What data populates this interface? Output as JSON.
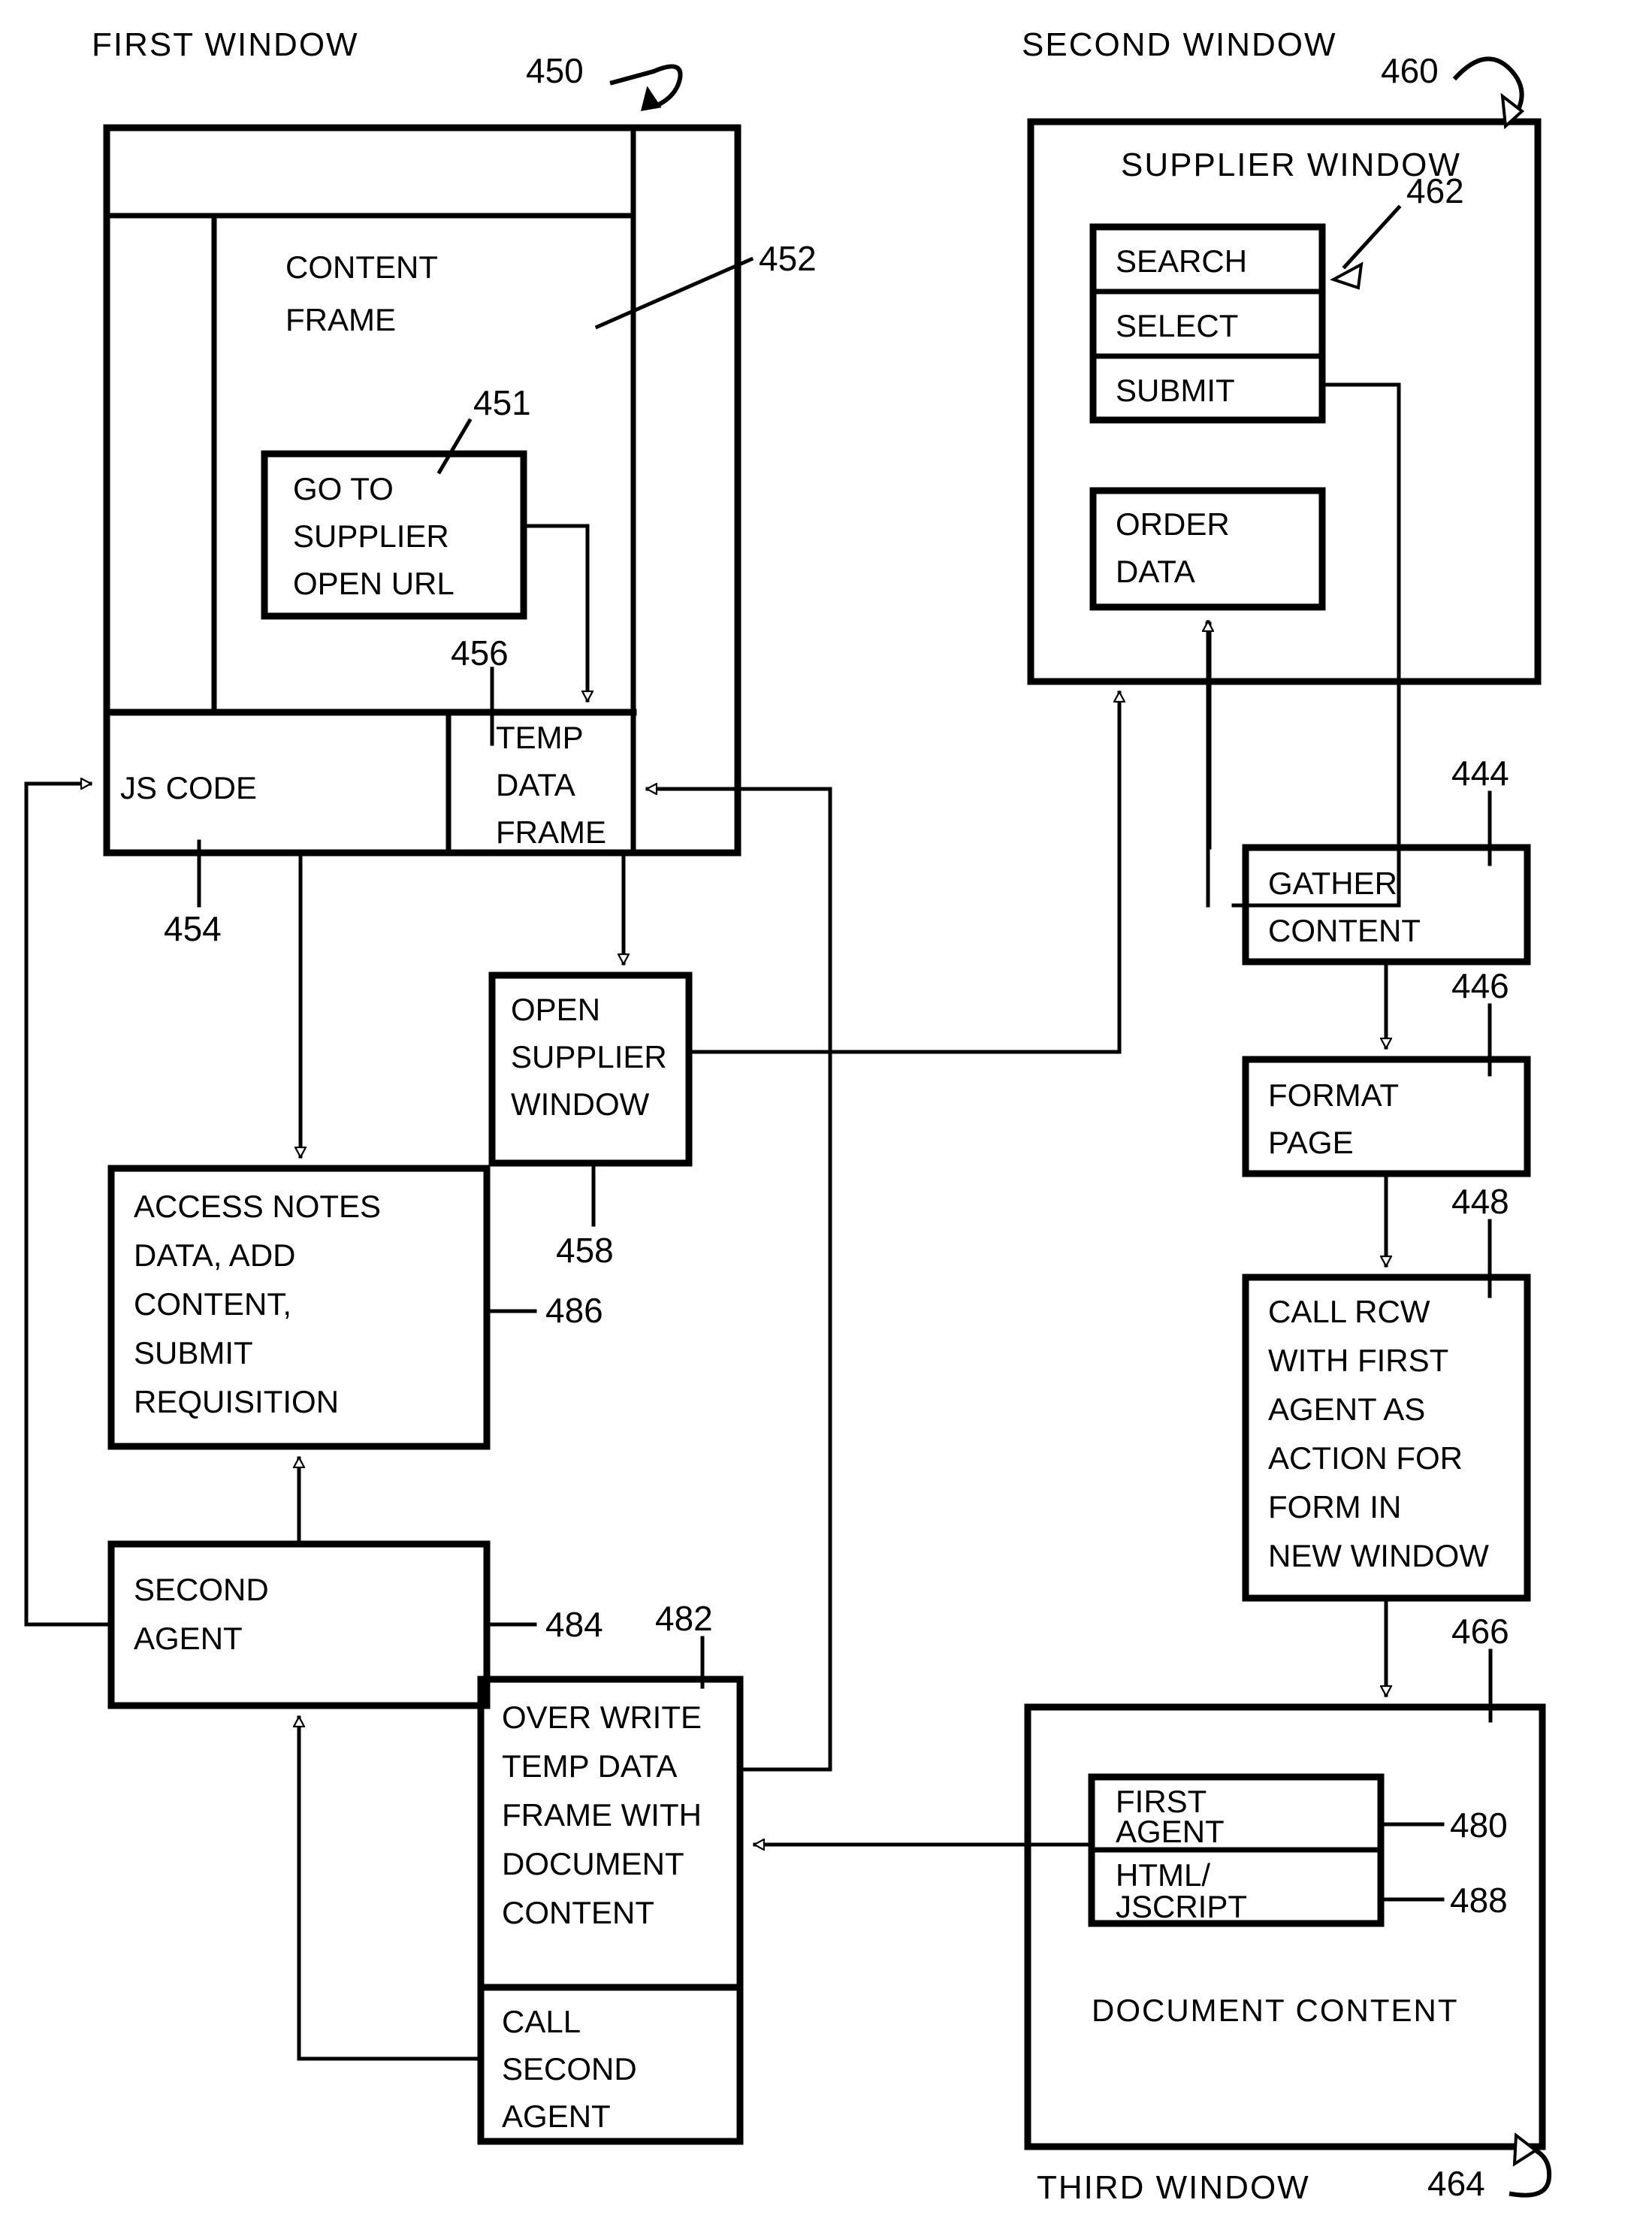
{
  "figure": {
    "type": "patent-flow-diagram",
    "background": "#ffffff",
    "ink": "#000000"
  },
  "labels": {
    "first_window": "FIRST WINDOW",
    "second_window": "SECOND WINDOW",
    "third_window": "THIRD WINDOW",
    "supplier_window": "SUPPLIER WINDOW",
    "content_frame_line1": "CONTENT",
    "content_frame_line2": "FRAME",
    "document_content": "DOCUMENT CONTENT"
  },
  "blocks": {
    "go_to_supplier": [
      "GO TO",
      "SUPPLIER",
      "OPEN URL"
    ],
    "js_code": [
      "JS CODE"
    ],
    "temp_data_frame": [
      "TEMP",
      "DATA",
      "FRAME"
    ],
    "open_supplier_window": [
      "OPEN",
      "SUPPLIER",
      "WINDOW"
    ],
    "access_notes": [
      "ACCESS NOTES",
      "DATA, ADD",
      "CONTENT,",
      "SUBMIT",
      "REQUISITION"
    ],
    "second_agent": [
      "SECOND",
      "AGENT"
    ],
    "over_write": [
      "OVER WRITE",
      "TEMP DATA",
      "FRAME WITH",
      "DOCUMENT",
      "CONTENT"
    ],
    "call_second_agent": [
      "CALL",
      "SECOND",
      "AGENT"
    ],
    "search": [
      "SEARCH"
    ],
    "select": [
      "SELECT"
    ],
    "submit": [
      "SUBMIT"
    ],
    "order_data": [
      "ORDER",
      "DATA"
    ],
    "gather_content": [
      "GATHER",
      "CONTENT"
    ],
    "format_page": [
      "FORMAT",
      "PAGE"
    ],
    "call_rcw": [
      "CALL RCW",
      "WITH FIRST",
      "AGENT AS",
      "ACTION FOR",
      "FORM IN",
      "NEW WINDOW"
    ],
    "first_agent": [
      "FIRST",
      "AGENT"
    ],
    "html_jscript": [
      "HTML/",
      "JSCRIPT"
    ]
  },
  "reference_numerals": {
    "n450": "450",
    "n451": "451",
    "n452": "452",
    "n454": "454",
    "n456": "456",
    "n458": "458",
    "n460": "460",
    "n462": "462",
    "n464": "464",
    "n466": "466",
    "n444": "444",
    "n446": "446",
    "n448": "448",
    "n480": "480",
    "n482": "482",
    "n484": "484",
    "n486": "486",
    "n488": "488"
  }
}
